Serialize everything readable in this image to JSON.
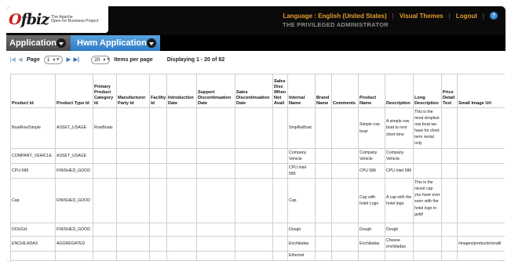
{
  "header": {
    "logo_mark": "fbiz",
    "logo_accent": "O",
    "logo_tag_line1": "The Apache",
    "logo_tag_line2": "Open for Business Project",
    "language_link": "Language : English (United States)",
    "visual_themes_link": "Visual Themes",
    "logout_link": "Logout",
    "help_icon": "?",
    "user_name": "THE PRIVILEGED ADMINISTRATOR"
  },
  "tabs": {
    "applications_label": "Applications",
    "current_app_label": "Hwm Application"
  },
  "pager": {
    "page_label": "Page",
    "page_value": "1",
    "page_size_value": "20",
    "items_per_page_label": "Items per page",
    "display_text": "Displaying 1 - 20 of 82"
  },
  "table": {
    "columns": [
      "Product Id",
      "Product Type Id",
      "Primary Product Category Id",
      "Manufacturer Party Id",
      "Facility Id",
      "Introduction Date",
      "Support Discontinuation Date",
      "Sales Discontinuation Date",
      "Sales Disc When Not Avail",
      "Internal Name",
      "Brand Name",
      "Comments",
      "Product Name",
      "Description",
      "Long Description",
      "Price Detail Text",
      "Small Image Url"
    ],
    "rows": [
      [
        "BoatRowSimple",
        "ASSET_USAGE",
        "RowBoats",
        "",
        "",
        "",
        "",
        "",
        "",
        "SmpRwBoat",
        "",
        "",
        "Simple row boat",
        "A simple row boat to rent short time",
        "This is the most simplest row boat we have for short term rental only",
        "",
        ""
      ],
      [
        "COMPANY_VEHICLE",
        "ASSET_USAGE",
        "",
        "",
        "",
        "",
        "",
        "",
        "",
        "Company Vehicle",
        "",
        "",
        "Company Vehicle",
        "Company Vehicle.",
        "",
        "",
        ""
      ],
      [
        "CPU-586",
        "FINISHED_GOOD",
        "",
        "",
        "",
        "",
        "",
        "",
        "",
        "CPU Intel 586",
        "",
        "",
        "CPU 586",
        "CPU Intel 586",
        "",
        "",
        ""
      ],
      [
        "Cap",
        "FINISHED_GOOD",
        "",
        "",
        "",
        "",
        "",
        "",
        "",
        "Cap",
        "",
        "",
        "Cap with hotel Logo",
        "A cap with the hotel logo",
        "This is the nicest cap you have ever seen with the hotel logo in gold!",
        "",
        ""
      ],
      [
        "DOUGH",
        "FINISHED_GOOD",
        "",
        "",
        "",
        "",
        "",
        "",
        "",
        "Dough",
        "",
        "",
        "Dough",
        "Dough",
        "",
        "",
        ""
      ],
      [
        "ENCHILADAS",
        "AGGREGATED",
        "",
        "",
        "",
        "",
        "",
        "",
        "",
        "Enchiladas",
        "",
        "",
        "Enchiladas",
        "Cheese enchiladas",
        "",
        "",
        "/images/products/small/"
      ],
      [
        "",
        "",
        "",
        "",
        "",
        "",
        "",
        "",
        "",
        "Ethernet",
        "",
        "",
        "",
        "",
        "",
        "",
        ""
      ]
    ]
  },
  "colors": {
    "link_orange": "#e69d2e",
    "tab_blue": "#2f7cc7",
    "header_bg": "#0a0a0a"
  }
}
